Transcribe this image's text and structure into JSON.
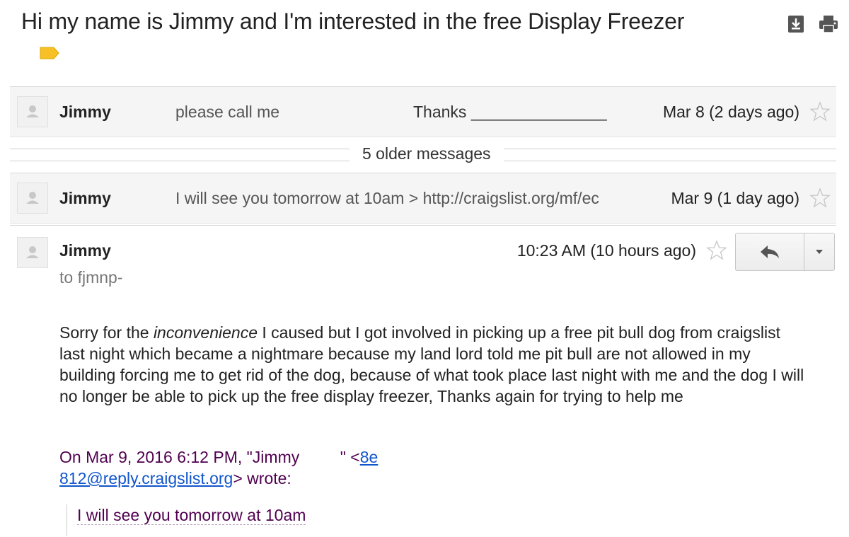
{
  "subject": "Hi my name is Jimmy and I'm interested in the free Display Freezer",
  "icons": {
    "label": "label-tag-icon",
    "download": "download-icon",
    "print": "print-icon",
    "star": "star-icon",
    "reply": "reply-arrow-icon",
    "more": "chevron-down-icon",
    "avatar": "person-icon"
  },
  "colors": {
    "label_tag": "#f6c026",
    "quote_text": "#500050",
    "link": "#1155cc",
    "collapsed_bg": "#f5f5f5"
  },
  "messages_collapsed": [
    {
      "sender": "Jimmy",
      "snippet": "please call me",
      "snippet2": "Thanks _______________",
      "date": "Mar 8 (2 days ago)"
    },
    {
      "sender": "Jimmy",
      "snippet": "I will see you tomorrow at 10am > http://craigslist.org/mf/ec",
      "date": "Mar 9 (1 day ago)"
    }
  ],
  "older_messages_label": "5 older messages",
  "open_message": {
    "sender": "Jimmy",
    "to": "to fjmnp-",
    "date": "10:23 AM (10 hours ago)",
    "body_start": "Sorry for the ",
    "body_emphasis": "inconvenience",
    "body_rest": " I caused but I got involved  in picking up a free pit bull dog  from craigslist last night which became a nightmare because my land lord told me pit bull are not allowed in my building forcing me to get rid of the dog, because of what took place last night with me and the dog I will no longer be able to pick up the free display freezer, Thanks again for trying to help me",
    "quote_header_part1": "On Mar 9, 2016 6:12 PM, \"Jimmy         \" <",
    "quote_link_part1": "8e",
    "quote_link_part2": "812@reply.craigslist.org",
    "quote_header_part2": "> wrote:",
    "quoted_text": "I will see you tomorrow at 10am"
  }
}
